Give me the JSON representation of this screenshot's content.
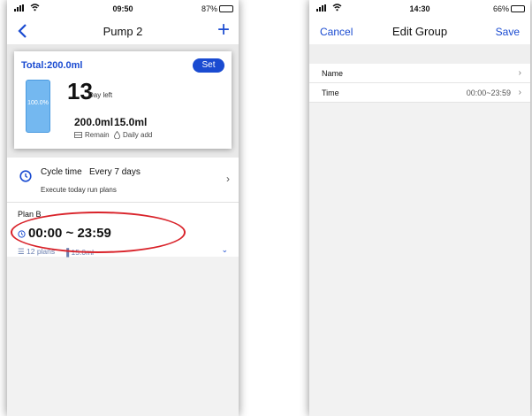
{
  "left": {
    "status": {
      "time": "09:50",
      "battery": "87%",
      "battery_level": 0.87
    },
    "nav": {
      "title": "Pump 2"
    },
    "card": {
      "total": "Total:200.0ml",
      "set_label": "Set",
      "tank_percent": "100.0%",
      "days": "13",
      "days_label": "Day left",
      "remain_value": "200.0ml",
      "remain_label": "Remain",
      "daily_value": "15.0ml",
      "daily_label": "Daily add"
    },
    "cycle": {
      "title": "Cycle time   Every 7 days",
      "subtitle": "Execute today run plans"
    },
    "plan": {
      "name": "Plan B",
      "time_range": "00:00 ~ 23:59",
      "plans_count": "12 plans",
      "amount": "15.0ml"
    }
  },
  "right": {
    "status": {
      "time": "14:30",
      "battery": "66%",
      "battery_level": 0.66
    },
    "nav": {
      "cancel": "Cancel",
      "title": "Edit Group",
      "save": "Save"
    },
    "rows": [
      {
        "label": "Name",
        "value": ""
      },
      {
        "label": "Time",
        "value": "00:00~23:59"
      }
    ]
  },
  "colors": {
    "accent": "#1a4bd1",
    "annotation": "#d9232a",
    "tank": "#74b8f0"
  },
  "icons": [
    "signal-icon",
    "wifi-icon",
    "battery-icon",
    "back-chevron-icon",
    "plus-icon",
    "clock-icon",
    "drop-icon",
    "list-icon",
    "bar-icon",
    "chevron-right-icon",
    "chevron-down-icon"
  ]
}
